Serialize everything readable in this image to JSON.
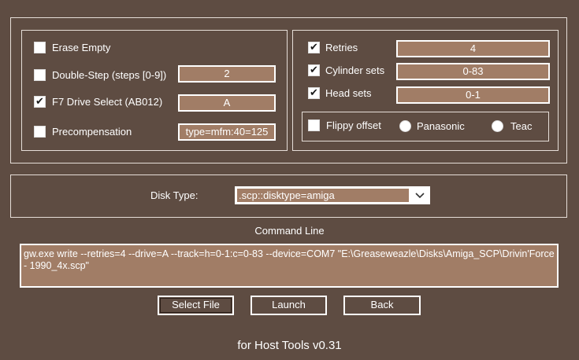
{
  "options_left": {
    "erase_empty": {
      "label": "Erase Empty",
      "checked": false
    },
    "double_step": {
      "label": "Double-Step (steps [0-9])",
      "checked": false,
      "value": "2"
    },
    "f7_drive_select": {
      "label": "F7 Drive Select (AB012)",
      "checked": true,
      "value": "A"
    },
    "precompensation": {
      "label": "Precompensation",
      "checked": false,
      "value": "type=mfm:40=125"
    }
  },
  "options_right": {
    "retries": {
      "label": "Retries",
      "checked": true,
      "value": "4"
    },
    "cylinder_sets": {
      "label": "Cylinder sets",
      "checked": true,
      "value": "0-83"
    },
    "head_sets": {
      "label": "Head sets",
      "checked": true,
      "value": "0-1"
    },
    "flippy_offset": {
      "label": "Flippy offset",
      "checked": false
    },
    "radio_panasonic": {
      "label": "Panasonic"
    },
    "radio_teac": {
      "label": "Teac"
    }
  },
  "disk_type": {
    "label": "Disk Type:",
    "selected": ".scp::disktype=amiga"
  },
  "command_line": {
    "label": "Command Line",
    "text": "gw.exe write --retries=4 --drive=A --track=h=0-1:c=0-83 --device=COM7 \"E:\\Greaseweazle\\Disks\\Amiga_SCP\\Drivin'Force - 1990_4x.scp\""
  },
  "buttons": {
    "select_file": "Select File",
    "launch": "Launch",
    "back": "Back"
  },
  "footer": {
    "title": "for Host Tools v0.31"
  },
  "icons": {
    "check": "✔",
    "dropdown": "chevron-down-icon"
  },
  "colors": {
    "background": "#5e4c42",
    "field": "#a17d66",
    "border": "#ffffff"
  }
}
